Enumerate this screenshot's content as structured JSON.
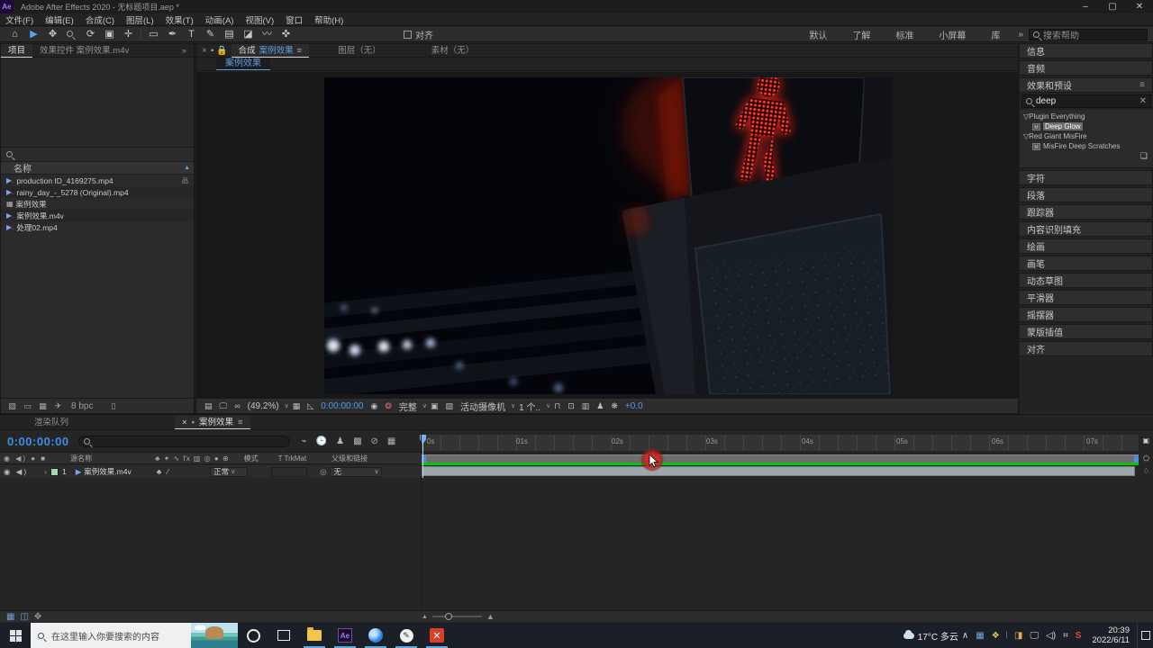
{
  "window": {
    "logo": "Ae",
    "title": "Adobe After Effects 2020 - 无标题项目.aep *",
    "minimize": "–",
    "maximize": "▢",
    "close": "✕"
  },
  "menu": {
    "items": [
      "文件(F)",
      "编辑(E)",
      "合成(C)",
      "图层(L)",
      "效果(T)",
      "动画(A)",
      "视图(V)",
      "窗口",
      "帮助(H)"
    ]
  },
  "toolbar": {
    "align_label": "对齐",
    "workspaces": [
      "默认",
      "了解",
      "标准",
      "小屏幕",
      "库"
    ],
    "overflow": "»",
    "search_placeholder": "搜索帮助",
    "icons": {
      "home": "⌂",
      "selection": "▶",
      "hand": "✥",
      "rotate": "⟳",
      "camera": "▣",
      "pan": "✛",
      "shape": "▭",
      "pen": "✒",
      "type": "T",
      "brush": "✎",
      "clone": "▤",
      "eraser": "◪",
      "roto": "〰",
      "puppet": "✜"
    }
  },
  "project": {
    "tabs": [
      {
        "label": "项目"
      },
      {
        "label": "效果控件 案例效果.m4v"
      }
    ],
    "overflow": "»",
    "name_header": "名称",
    "sort_icon": "▲",
    "items": [
      {
        "label": "production ID_4169275.mp4",
        "type": "footage",
        "badge": "品"
      },
      {
        "label": "rainy_day_-_5278 (Original).mp4",
        "type": "footage",
        "badge": ""
      },
      {
        "label": "案例效果",
        "type": "comp",
        "badge": ""
      },
      {
        "label": "案例效果.m4v",
        "type": "footage",
        "badge": ""
      },
      {
        "label": "处理02.mp4",
        "type": "footage",
        "badge": ""
      }
    ],
    "bpc": "8 bpc",
    "trash_icon": "🗑"
  },
  "viewer": {
    "close_icon": "×",
    "comp_word": "合成",
    "comp_name": "案例效果",
    "tab_layer": "图层（无）",
    "tab_footage": "素材（无）",
    "sub_tab": "案例效果",
    "zoom": "(49.2%)",
    "timecode": "0:00:00:00",
    "resolution": "完整",
    "camera": "活动摄像机",
    "views": "1 个..",
    "exposure": "+0.0"
  },
  "right_panels": {
    "info": "信息",
    "audio": "音频",
    "collapsed": [
      "字符",
      "段落",
      "跟踪器",
      "内容识别填充",
      "绘画",
      "画笔",
      "动态草图",
      "平滑器",
      "摇摆器",
      "蒙版插值",
      "对齐"
    ]
  },
  "effects_panel": {
    "title": "效果和预设",
    "menu_icon": "≡",
    "search_value": "deep",
    "clear_icon": "✕",
    "groups": [
      {
        "name": "▽Plugin Everything",
        "children": [
          {
            "label": "Deep Glow",
            "selected": true
          }
        ]
      },
      {
        "name": "▽Red Giant MisFire",
        "children": [
          {
            "label": "MisFire Deep Scratches",
            "selected": false
          }
        ]
      }
    ]
  },
  "timeline": {
    "tab_render_queue": "渲染队列",
    "tab_comp": "案例效果",
    "close_icon": "×",
    "menu_icon": "≡",
    "timecode": "0:00:00:00",
    "columns": {
      "source_name": "源名称",
      "switches": "♣ ✦ ∿ fx ▥ ◎ ● ⊕",
      "mode": "模式",
      "trkmat": "T  TrkMat",
      "parent": "父级和链接"
    },
    "left_icons": "◉ ◀) ● ■",
    "layer": {
      "av": "◉ ◀)",
      "expand": "›",
      "index": "1",
      "icon": "▶",
      "name": "案例效果.m4v",
      "sw": "♣  ∕",
      "mode": "正常",
      "link_icon": "◎",
      "parent": "无"
    },
    "ruler_ticks": [
      "0s",
      "01s",
      "02s",
      "03s",
      "04s",
      "05s",
      "06s",
      "07s"
    ]
  },
  "taskbar": {
    "search_placeholder": "在这里输入你要搜索的内容",
    "weather": "17°C 多云",
    "tray_expand": "∧",
    "tray_icons": [
      "▦",
      "❖",
      "🎤",
      "◨",
      "🖵",
      "◁)",
      "⌗",
      "S"
    ],
    "time": "20:39",
    "date": "2022/6/11"
  }
}
